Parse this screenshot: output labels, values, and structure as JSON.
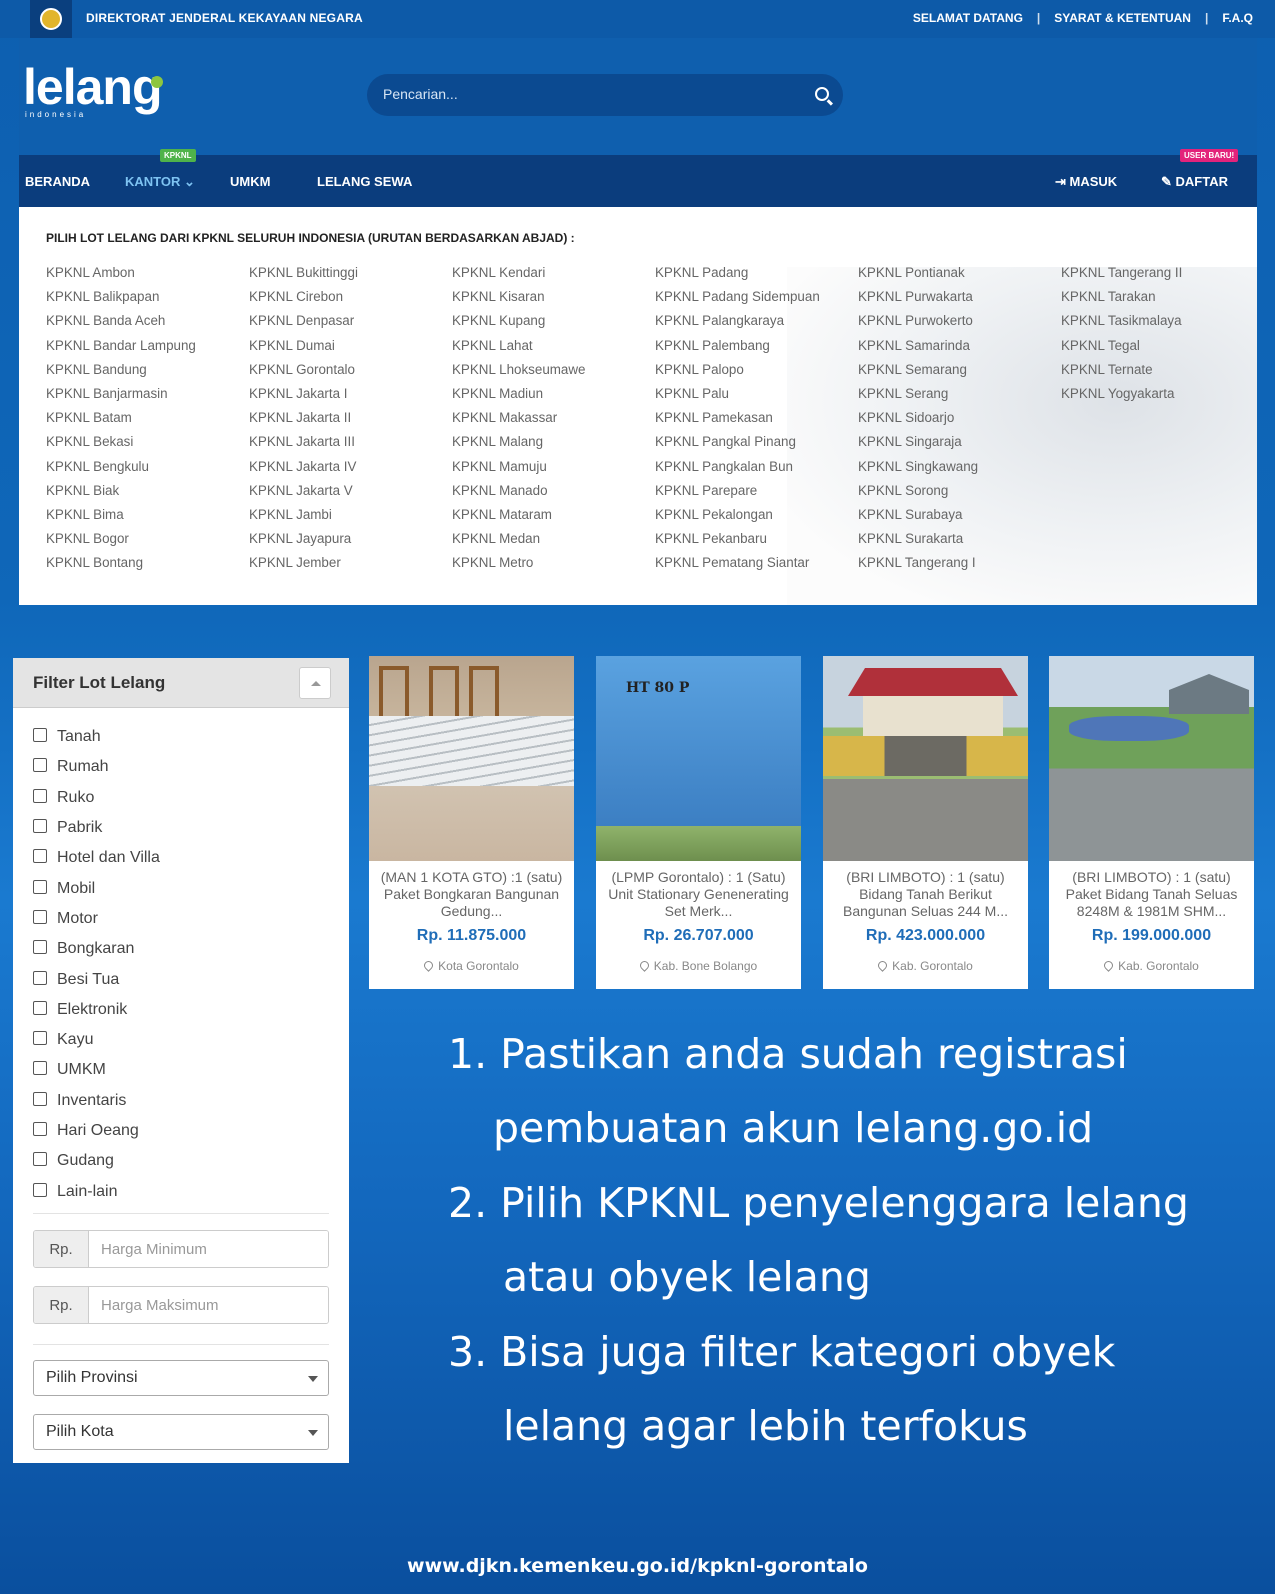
{
  "topbar": {
    "directorate": "DIREKTORAT JENDERAL KEKAYAAN NEGARA",
    "links": [
      "SELAMAT DATANG",
      "SYARAT & KETENTUAN",
      "F.A.Q"
    ]
  },
  "header": {
    "logo_text": "lelang",
    "logo_sub": "indonesia",
    "search_placeholder": "Pencarian..."
  },
  "nav": {
    "beranda": "BERANDA",
    "kantor": "KANTOR",
    "kantor_badge": "KPKNL",
    "umkm": "UMKM",
    "lelang_sewa": "LELANG SEWA",
    "masuk": "MASUK",
    "daftar": "DAFTAR",
    "daftar_badge": "USER BARU!"
  },
  "kpknl_panel": {
    "heading": "PILIH LOT LELANG DARI KPKNL SELURUH INDONESIA (URUTAN BERDASARKAN ABJAD) :",
    "columns": [
      [
        "KPKNL Ambon",
        "KPKNL Balikpapan",
        "KPKNL Banda Aceh",
        "KPKNL Bandar Lampung",
        "KPKNL Bandung",
        "KPKNL Banjarmasin",
        "KPKNL Batam",
        "KPKNL Bekasi",
        "KPKNL Bengkulu",
        "KPKNL Biak",
        "KPKNL Bima",
        "KPKNL Bogor",
        "KPKNL Bontang"
      ],
      [
        "KPKNL Bukittinggi",
        "KPKNL Cirebon",
        "KPKNL Denpasar",
        "KPKNL Dumai",
        "KPKNL Gorontalo",
        "KPKNL Jakarta I",
        "KPKNL Jakarta II",
        "KPKNL Jakarta III",
        "KPKNL Jakarta IV",
        "KPKNL Jakarta V",
        "KPKNL Jambi",
        "KPKNL Jayapura",
        "KPKNL Jember"
      ],
      [
        "KPKNL Kendari",
        "KPKNL Kisaran",
        "KPKNL Kupang",
        "KPKNL Lahat",
        "KPKNL Lhokseumawe",
        "KPKNL Madiun",
        "KPKNL Makassar",
        "KPKNL Malang",
        "KPKNL Mamuju",
        "KPKNL Manado",
        "KPKNL Mataram",
        "KPKNL Medan",
        "KPKNL Metro"
      ],
      [
        "KPKNL Padang",
        "KPKNL Padang Sidempuan",
        "KPKNL Palangkaraya",
        "KPKNL Palembang",
        "KPKNL Palopo",
        "KPKNL Palu",
        "KPKNL Pamekasan",
        "KPKNL Pangkal Pinang",
        "KPKNL Pangkalan Bun",
        "KPKNL Parepare",
        "KPKNL Pekalongan",
        "KPKNL Pekanbaru",
        "KPKNL Pematang Siantar"
      ],
      [
        "KPKNL Pontianak",
        "KPKNL Purwakarta",
        "KPKNL Purwokerto",
        "KPKNL Samarinda",
        "KPKNL Semarang",
        "KPKNL Serang",
        "KPKNL Sidoarjo",
        "KPKNL Singaraja",
        "KPKNL Singkawang",
        "KPKNL Sorong",
        "KPKNL Surabaya",
        "KPKNL Surakarta",
        "KPKNL Tangerang I"
      ],
      [
        "KPKNL Tangerang II",
        "KPKNL Tarakan",
        "KPKNL Tasikmalaya",
        "KPKNL Tegal",
        "KPKNL Ternate",
        "KPKNL Yogyakarta"
      ]
    ]
  },
  "filter": {
    "title": "Filter Lot Lelang",
    "categories": [
      "Tanah",
      "Rumah",
      "Ruko",
      "Pabrik",
      "Hotel dan Villa",
      "Mobil",
      "Motor",
      "Bongkaran",
      "Besi Tua",
      "Elektronik",
      "Kayu",
      "UMKM",
      "Inventaris",
      "Hari Oeang",
      "Gudang",
      "Lain-lain"
    ],
    "currency_prefix": "Rp.",
    "min_placeholder": "Harga Minimum",
    "max_placeholder": "Harga Maksimum",
    "province_select": "Pilih Provinsi",
    "city_select": "Pilih Kota"
  },
  "cards": [
    {
      "title": "(MAN 1 KOTA GTO) :1 (satu) Paket Bongkaran Bangunan Gedung...",
      "price": "Rp. 11.875.000",
      "location": "Kota Gorontalo"
    },
    {
      "title": "(LPMP Gorontalo) : 1 (Satu) Unit Stationary Genenerating Set Merk...",
      "price": "Rp. 26.707.000",
      "location": "Kab. Bone Bolango",
      "image_text": "HT 80 P"
    },
    {
      "title": "(BRI LIMBOTO) : 1 (satu) Bidang Tanah Berikut Bangunan Seluas 244 M...",
      "price": "Rp. 423.000.000",
      "location": "Kab. Gorontalo"
    },
    {
      "title": "(BRI LIMBOTO) : 1 (satu) Paket Bidang Tanah Seluas 8248M & 1981M SHM...",
      "price": "Rp. 199.000.000",
      "location": "Kab. Gorontalo"
    }
  ],
  "steps": {
    "l1": "1. Pastikan anda sudah registrasi",
    "l2": "pembuatan akun lelang.go.id",
    "l3": "2. Pilih KPKNL penyelenggara lelang",
    "l4": "atau obyek lelang",
    "l5": "3. Bisa juga filter kategori obyek",
    "l6": "lelang agar lebih terfokus"
  },
  "footer_url": "www.djkn.kemenkeu.go.id/kpknl-gorontalo",
  "colors": {
    "brand_blue": "#0f5fae",
    "nav_blue": "#0b3d7d",
    "price_blue": "#1f6db8",
    "badge_green": "#4fb34a",
    "badge_pink": "#e3237b"
  }
}
